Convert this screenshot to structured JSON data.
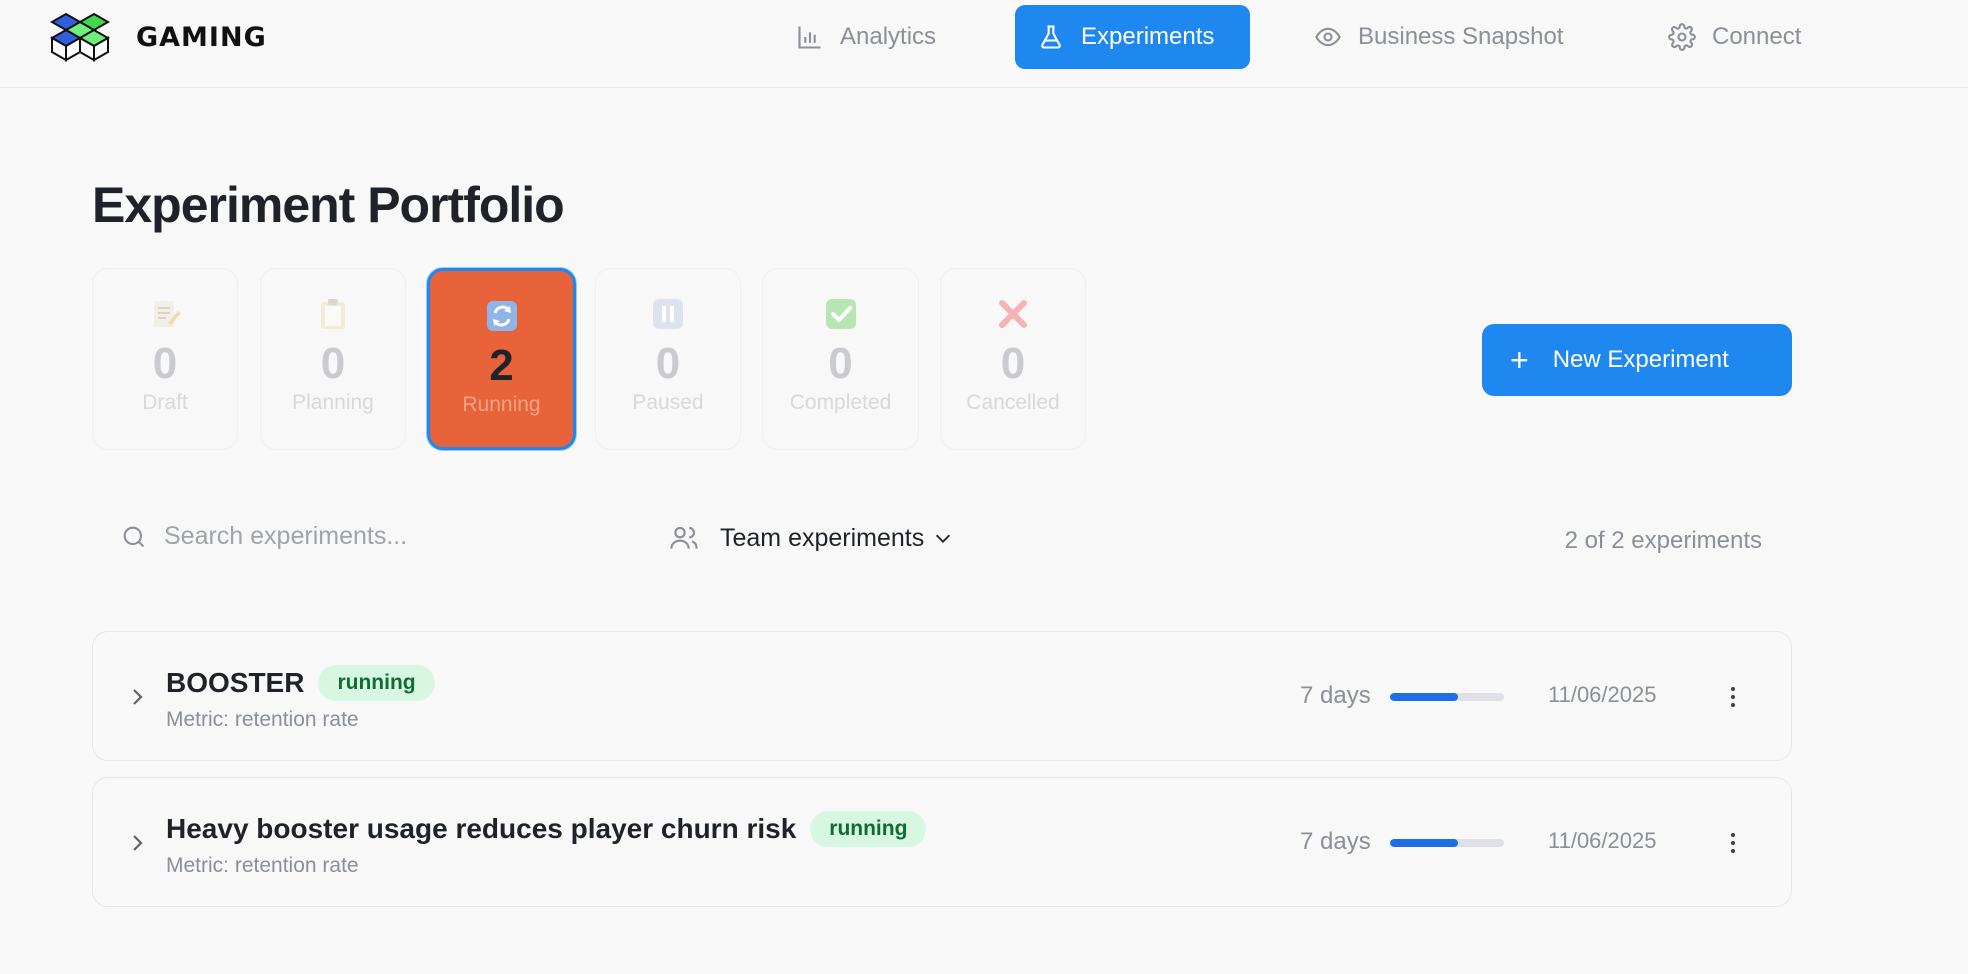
{
  "brand": {
    "name": "GAMING"
  },
  "nav": {
    "items": [
      {
        "label": "Analytics",
        "icon": "bar-chart-icon"
      },
      {
        "label": "Experiments",
        "icon": "flask-icon",
        "active": true
      },
      {
        "label": "Business Snapshot",
        "icon": "eye-icon"
      },
      {
        "label": "Connect",
        "icon": "gear-icon"
      }
    ]
  },
  "page": {
    "title": "Experiment Portfolio"
  },
  "stats": [
    {
      "emoji": "📝",
      "count": "0",
      "label": "Draft"
    },
    {
      "emoji": "📋",
      "count": "0",
      "label": "Planning"
    },
    {
      "emoji": "🔄",
      "count": "2",
      "label": "Running",
      "active": true
    },
    {
      "emoji": "⏸",
      "count": "0",
      "label": "Paused"
    },
    {
      "emoji": "✅",
      "count": "0",
      "label": "Completed"
    },
    {
      "emoji": "❌",
      "count": "0",
      "label": "Cancelled"
    }
  ],
  "actions": {
    "new_experiment": "New Experiment",
    "plus": "+"
  },
  "filters": {
    "search_placeholder": "Search experiments...",
    "team_label": "Team experiments",
    "count_text": "2 of 2 experiments"
  },
  "experiments": [
    {
      "title": "BOOSTER",
      "status": "running",
      "metric": "Metric: retention rate",
      "duration": "7 days",
      "progress": 0.6,
      "date": "11/06/2025"
    },
    {
      "title": "Heavy booster usage reduces player churn risk",
      "status": "running",
      "metric": "Metric: retention rate",
      "duration": "7 days",
      "progress": 0.6,
      "date": "11/06/2025"
    }
  ],
  "colors": {
    "accent": "#1e88f0",
    "running_card": "#e8623a",
    "badge_bg": "#d7f7e2",
    "badge_text": "#116b35",
    "progress": "#1e6fe6"
  }
}
